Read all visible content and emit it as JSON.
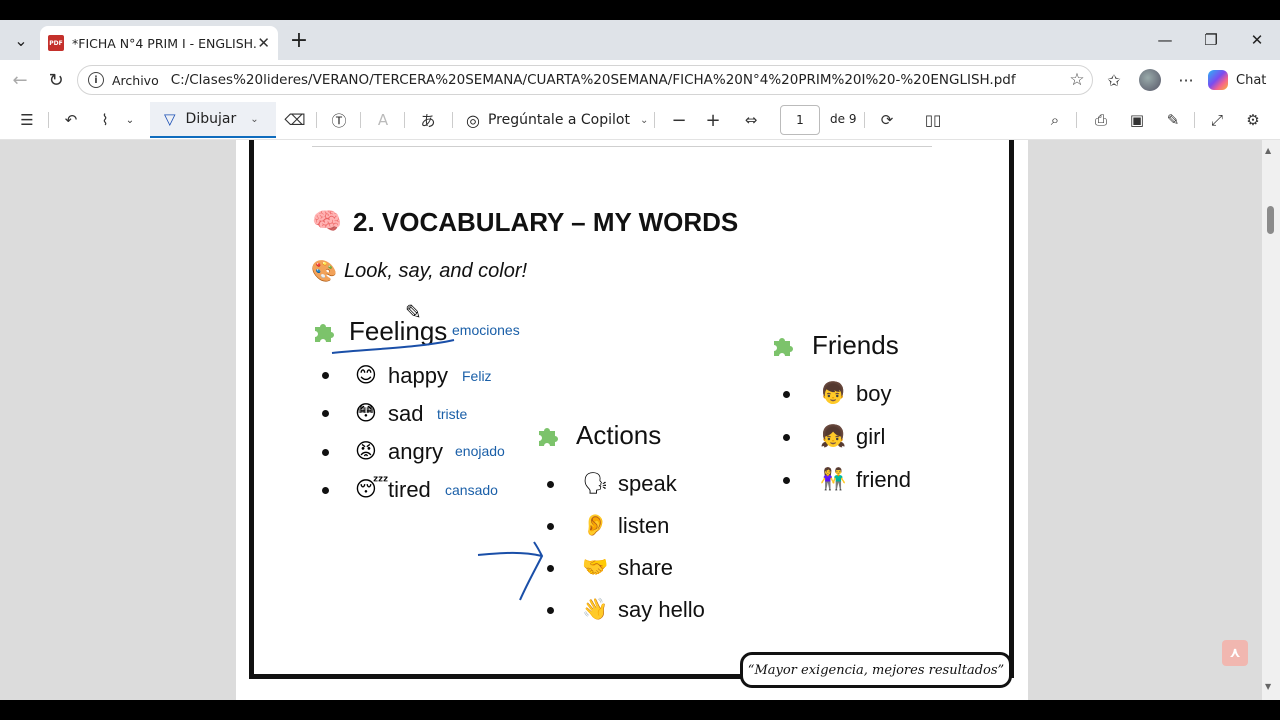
{
  "browser": {
    "tab_title": "*FICHA N°4 PRIM I - ENGLISH.pdf",
    "address_label": "Archivo",
    "url": "C:/Clases%20lideres/VERANO/TERCERA%20SEMANA/CUARTA%20SEMANA/FICHA%20N°4%20PRIM%20I%20-%20ENGLISH.pdf",
    "chat_label": "Chat"
  },
  "pdf_toolbar": {
    "draw_label": "Dibujar",
    "copilot_label": "Pregúntale a Copilot",
    "page_current": "1",
    "page_total": "de 9"
  },
  "document": {
    "heading": "2. VOCABULARY – MY WORDS",
    "subtitle": "Look, say, and color!",
    "feelings": {
      "title": "Feelings",
      "annotation": "emociones",
      "items": [
        {
          "word": "happy",
          "note": "Feliz",
          "emoji": "😊"
        },
        {
          "word": "sad",
          "note": "triste",
          "emoji": "😳"
        },
        {
          "word": "angry",
          "note": "enojado",
          "emoji": "😡"
        },
        {
          "word": "tired",
          "note": "cansado",
          "emoji": "😴"
        }
      ]
    },
    "actions": {
      "title": "Actions",
      "items": [
        {
          "word": "speak",
          "emoji": "🗣"
        },
        {
          "word": "listen",
          "emoji": "👂"
        },
        {
          "word": "share",
          "emoji": "🤝"
        },
        {
          "word": "say hello",
          "emoji": "👋"
        }
      ]
    },
    "friends": {
      "title": "Friends",
      "items": [
        {
          "word": "boy",
          "emoji": "👦"
        },
        {
          "word": "girl",
          "emoji": "👧"
        },
        {
          "word": "friend",
          "emoji": "👫"
        }
      ]
    },
    "motto": "“Mayor exigencia, mejores resultados”"
  },
  "icons": {
    "brain": "brain-icon",
    "palette": "palette-icon",
    "puzzle": "puzzle-icon"
  },
  "colors": {
    "accent": "#0f6cbd",
    "annotation_ink": "#1a5fa8",
    "puzzle_green": "#7cc36b"
  }
}
